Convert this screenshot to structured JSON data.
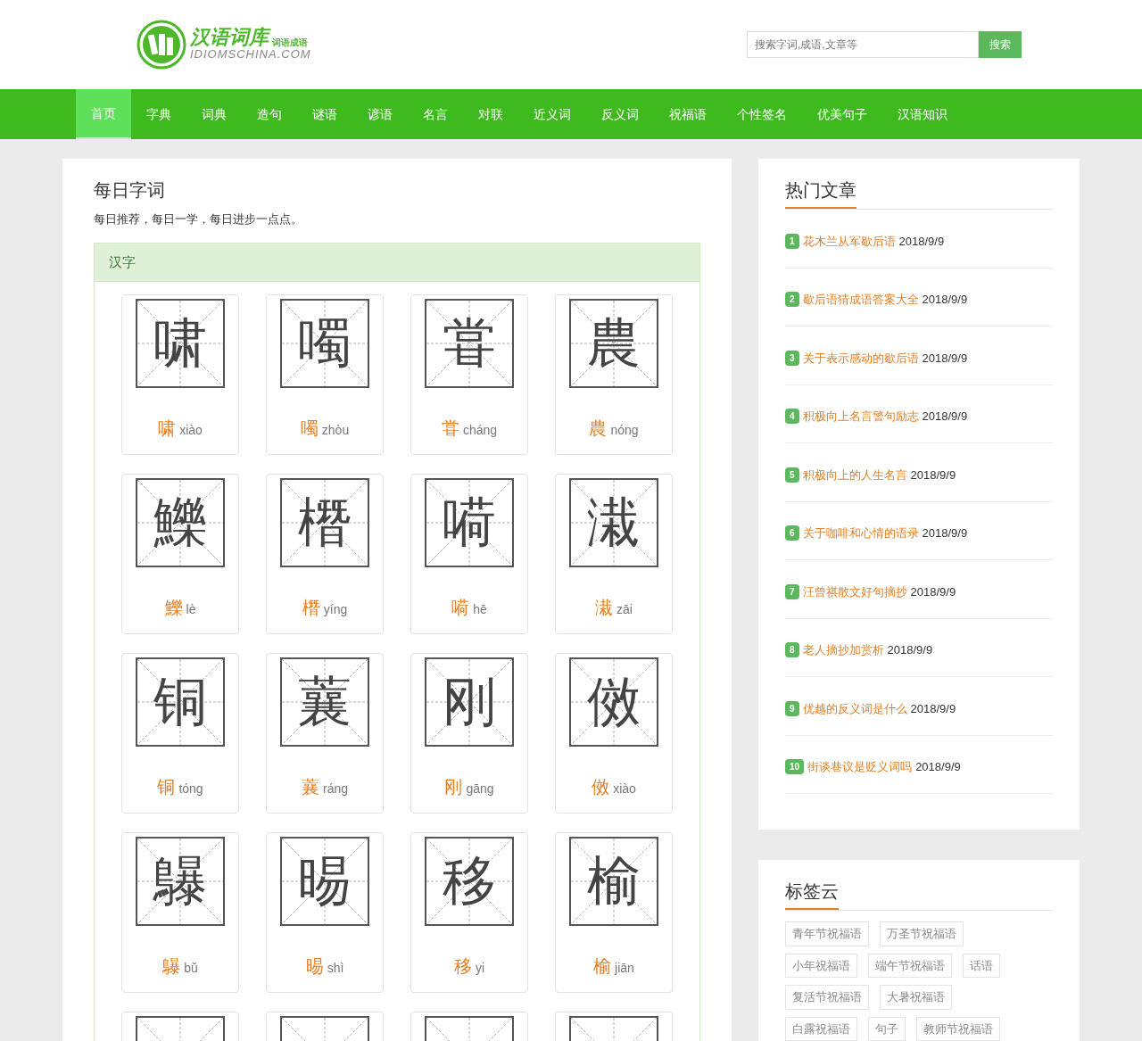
{
  "logo": {
    "title": "汉语词库",
    "subtitle": "词语成语",
    "domain": "IDIOMSCHINA.COM"
  },
  "search": {
    "placeholder": "搜索字词,成语,文章等",
    "button": "搜索"
  },
  "nav": [
    {
      "label": "首页",
      "selected": true
    },
    {
      "label": "字典",
      "selected": false
    },
    {
      "label": "词典",
      "selected": false
    },
    {
      "label": "造句",
      "selected": false
    },
    {
      "label": "谜语",
      "selected": false
    },
    {
      "label": "谚语",
      "selected": false
    },
    {
      "label": "名言",
      "selected": false
    },
    {
      "label": "对联",
      "selected": false
    },
    {
      "label": "近义词",
      "selected": false
    },
    {
      "label": "反义词",
      "selected": false
    },
    {
      "label": "祝福语",
      "selected": false
    },
    {
      "label": "个性签名",
      "selected": false
    },
    {
      "label": "优美句子",
      "selected": false
    },
    {
      "label": "汉语知识",
      "selected": false
    }
  ],
  "daily": {
    "title": "每日字词",
    "subtitle": "每日推荐，每日一学，每日进步一点点。",
    "section": "汉字",
    "characters": [
      {
        "glyph": "啸",
        "char": "啸",
        "pinyin": "xiào"
      },
      {
        "glyph": "噣",
        "char": "噣",
        "pinyin": "zhòu"
      },
      {
        "glyph": "甞",
        "char": "甞",
        "pinyin": "cháng"
      },
      {
        "glyph": "農",
        "char": "農",
        "pinyin": "nóng"
      },
      {
        "glyph": "鱳",
        "char": "鱳",
        "pinyin": "lè"
      },
      {
        "glyph": "橬",
        "char": "橬",
        "pinyin": "yíng"
      },
      {
        "glyph": "嗬",
        "char": "嗬",
        "pinyin": "hē"
      },
      {
        "glyph": "溨",
        "char": "溨",
        "pinyin": "zāi"
      },
      {
        "glyph": "铜",
        "char": "铜",
        "pinyin": "tóng"
      },
      {
        "glyph": "蘘",
        "char": "蘘",
        "pinyin": "ráng"
      },
      {
        "glyph": "刚",
        "char": "刚",
        "pinyin": "gāng"
      },
      {
        "glyph": "傚",
        "char": "傚",
        "pinyin": "xiào"
      },
      {
        "glyph": "鸔",
        "char": "鸔",
        "pinyin": "bǔ"
      },
      {
        "glyph": "晹",
        "char": "晹",
        "pinyin": "shì"
      },
      {
        "glyph": "移",
        "char": "移",
        "pinyin": "yi"
      },
      {
        "glyph": "榆",
        "char": "榆",
        "pinyin": "jiān"
      }
    ]
  },
  "hot_articles": {
    "title": "热门文章",
    "items": [
      {
        "rank": "1",
        "title": "花木兰从军歇后语",
        "date": "2018/9/9"
      },
      {
        "rank": "2",
        "title": "歇后语猜成语答案大全",
        "date": "2018/9/9"
      },
      {
        "rank": "3",
        "title": "关于表示感动的歇后语",
        "date": "2018/9/9"
      },
      {
        "rank": "4",
        "title": "积极向上名言警句励志",
        "date": "2018/9/9"
      },
      {
        "rank": "5",
        "title": "积极向上的人生名言",
        "date": "2018/9/9"
      },
      {
        "rank": "6",
        "title": "关于咖啡和心情的语录",
        "date": "2018/9/9"
      },
      {
        "rank": "7",
        "title": "汪曾祺散文好句摘抄",
        "date": "2018/9/9"
      },
      {
        "rank": "8",
        "title": "老人摘抄加赏析",
        "date": "2018/9/9"
      },
      {
        "rank": "9",
        "title": "优越的反义词是什么",
        "date": "2018/9/9"
      },
      {
        "rank": "10",
        "title": "街谈巷议是贬义词吗",
        "date": "2018/9/9"
      }
    ]
  },
  "tag_cloud": {
    "title": "标签云",
    "tags": [
      [
        "青年节祝福语",
        "万圣节祝福语"
      ],
      [
        "小年祝福语",
        "端午节祝福语",
        "话语"
      ],
      [
        "复活节祝福语",
        "大暑祝福语"
      ],
      [
        "白露祝福语",
        "句子",
        "教师节祝福语"
      ]
    ]
  }
}
